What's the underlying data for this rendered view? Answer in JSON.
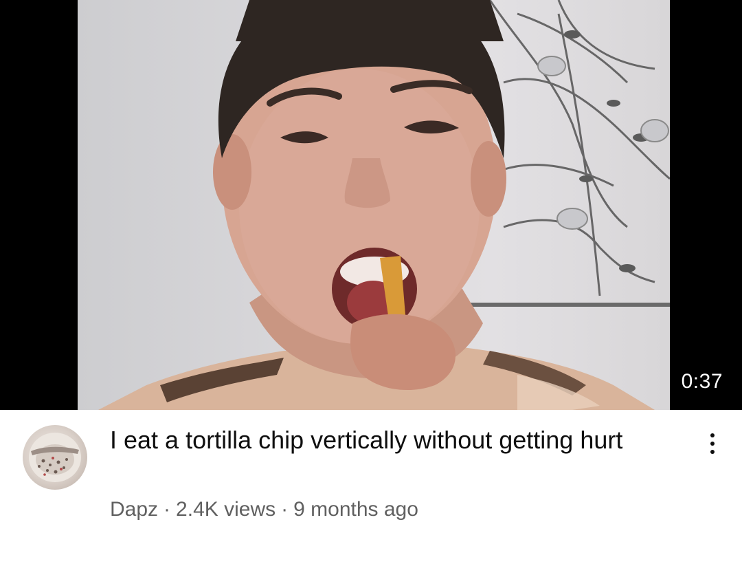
{
  "video": {
    "title": "I eat a tortilla chip vertically without getting hurt",
    "duration": "0:37",
    "channel": "Dapz",
    "views": "2.4K views",
    "age": "9 months ago",
    "separator": "·"
  },
  "icons": {
    "menu": "more-vertical-icon",
    "avatar": "channel-avatar"
  },
  "colors": {
    "title": "#0f0f0f",
    "meta": "#606060",
    "duration_bg": "#000000",
    "duration_text": "#ffffff"
  }
}
